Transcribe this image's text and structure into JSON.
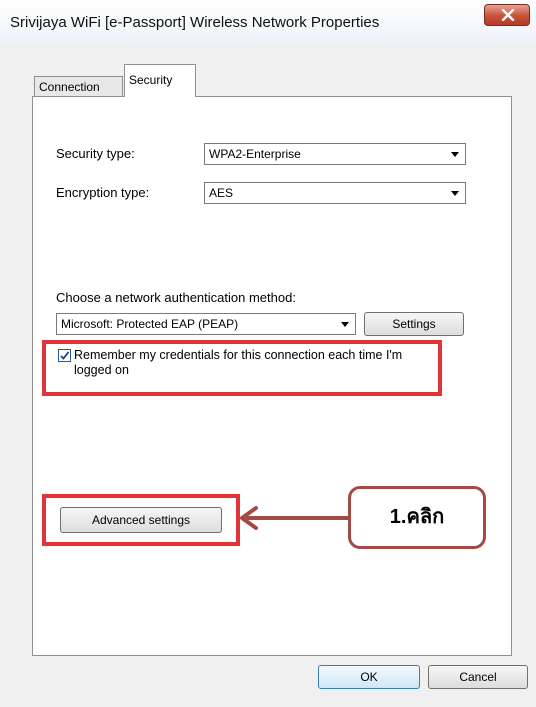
{
  "window": {
    "title": "Srivijaya WiFi [e-Passport] Wireless Network Properties"
  },
  "tabs": [
    {
      "label": "Connection",
      "selected": false
    },
    {
      "label": "Security",
      "selected": true
    }
  ],
  "security": {
    "security_type_label": "Security type:",
    "security_type_value": "WPA2-Enterprise",
    "encryption_type_label": "Encryption type:",
    "encryption_type_value": "AES",
    "auth_method_label": "Choose a network authentication method:",
    "auth_method_value": "Microsoft: Protected EAP (PEAP)",
    "settings_label": "Settings",
    "remember_checkbox_label": "Remember my credentials for this connection each time I'm logged on",
    "remember_checked": true,
    "advanced_settings_label": "Advanced settings"
  },
  "annotation": {
    "callout_text": "1.คลิก",
    "highlight_color": "#e0333a",
    "arrow_color": "#a44a45"
  },
  "footer": {
    "ok_label": "OK",
    "cancel_label": "Cancel"
  }
}
